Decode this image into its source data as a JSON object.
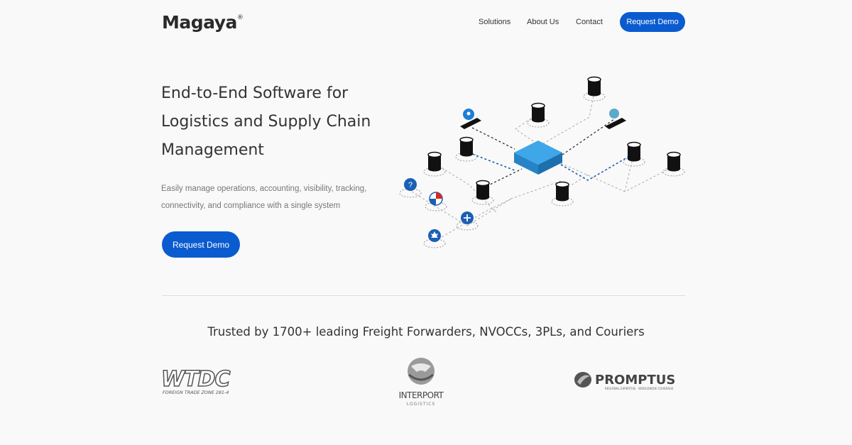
{
  "header": {
    "logo": "Magaya",
    "logo_mark": "®",
    "nav": [
      "Solutions",
      "About Us",
      "Contact"
    ],
    "cta": "Request Demo"
  },
  "hero": {
    "title_lines": [
      "End-to-End Software for",
      "Logistics and Supply Chain",
      "Management"
    ],
    "subtitle_lines": [
      "Easily manage operations, accounting, visibility, tracking,",
      "connectivity, and compliance with a single system"
    ],
    "cta": "Request Demo"
  },
  "trusted": {
    "heading": "Trusted by 1700+ leading Freight Forwarders, NVOCCs, 3PLs, and Couriers",
    "logos": [
      {
        "name": "WTDC",
        "tagline": "FOREIGN TRADE ZONE 281-4"
      },
      {
        "name": "INTERPORT",
        "tagline": "LOGISTICS"
      },
      {
        "name": "PROMPTUS",
        "tagline": "REGIONAL EXPERTISE · WORLDWIDE COVERAGE"
      }
    ]
  },
  "colors": {
    "accent": "#0b5bd0",
    "hub": "#3fa7e8",
    "text": "#333333"
  }
}
